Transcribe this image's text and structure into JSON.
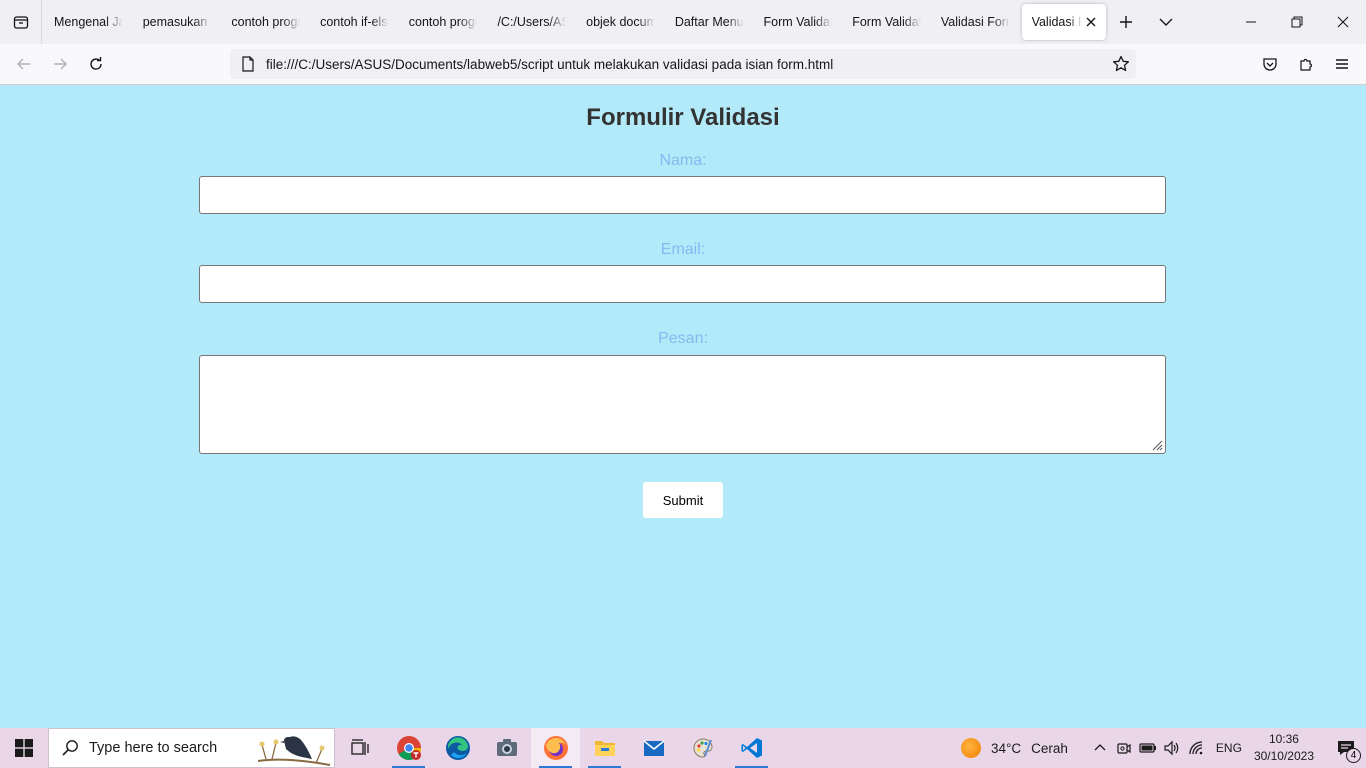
{
  "browser": {
    "tabs": [
      {
        "label": "Mengenal JavaScript"
      },
      {
        "label": "pemasukan data"
      },
      {
        "label": "contoh program"
      },
      {
        "label": "contoh if-else"
      },
      {
        "label": "contoh program"
      },
      {
        "label": "/C:/Users/ASUS"
      },
      {
        "label": "objek document"
      },
      {
        "label": "Daftar Menu"
      },
      {
        "label": "Form Validation"
      },
      {
        "label": "Form Validation"
      },
      {
        "label": "Validasi Form"
      },
      {
        "label": "Validasi Form",
        "active": true
      }
    ],
    "url": "file:///C:/Users/ASUS/Documents/labweb5/script untuk melakukan validasi pada isian form.html"
  },
  "page": {
    "title": "Formulir Validasi",
    "fields": {
      "nama_label": "Nama:",
      "nama_value": "",
      "email_label": "Email:",
      "email_value": "",
      "pesan_label": "Pesan:",
      "pesan_value": ""
    },
    "submit_label": "Submit"
  },
  "taskbar": {
    "search_placeholder": "Type here to search",
    "weather_temp": "34°C",
    "weather_condition": "Cerah",
    "language": "ENG",
    "time": "10:36",
    "date": "30/10/2023",
    "notification_count": "4"
  },
  "colors": {
    "page_background": "#b3eaf9",
    "label_color": "#86b9f1",
    "title_color": "#333333",
    "taskbar_background": "#e9d6e8"
  }
}
